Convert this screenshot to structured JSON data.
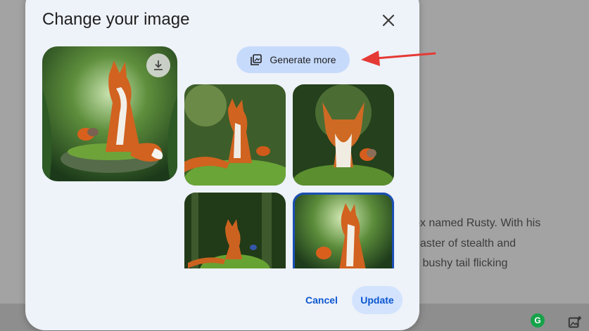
{
  "dialog": {
    "title": "Change your image",
    "generate_label": "Generate more",
    "cancel_label": "Cancel",
    "update_label": "Update"
  },
  "background": {
    "lines": [
      "ox named Rusty. With his",
      "naster of stealth and",
      "s bushy tail flicking"
    ]
  },
  "icons": {
    "close": "close-icon",
    "download": "download-icon",
    "generate": "image-stack-icon",
    "grammarly": "grammarly-icon",
    "add_image": "add-image-icon"
  },
  "colors": {
    "dialog_bg": "#eef2f9",
    "generate_bg": "#c6dafc",
    "accent": "#0b57d0",
    "selected_outline": "#1a4fb5",
    "arrow": "#e53935"
  }
}
